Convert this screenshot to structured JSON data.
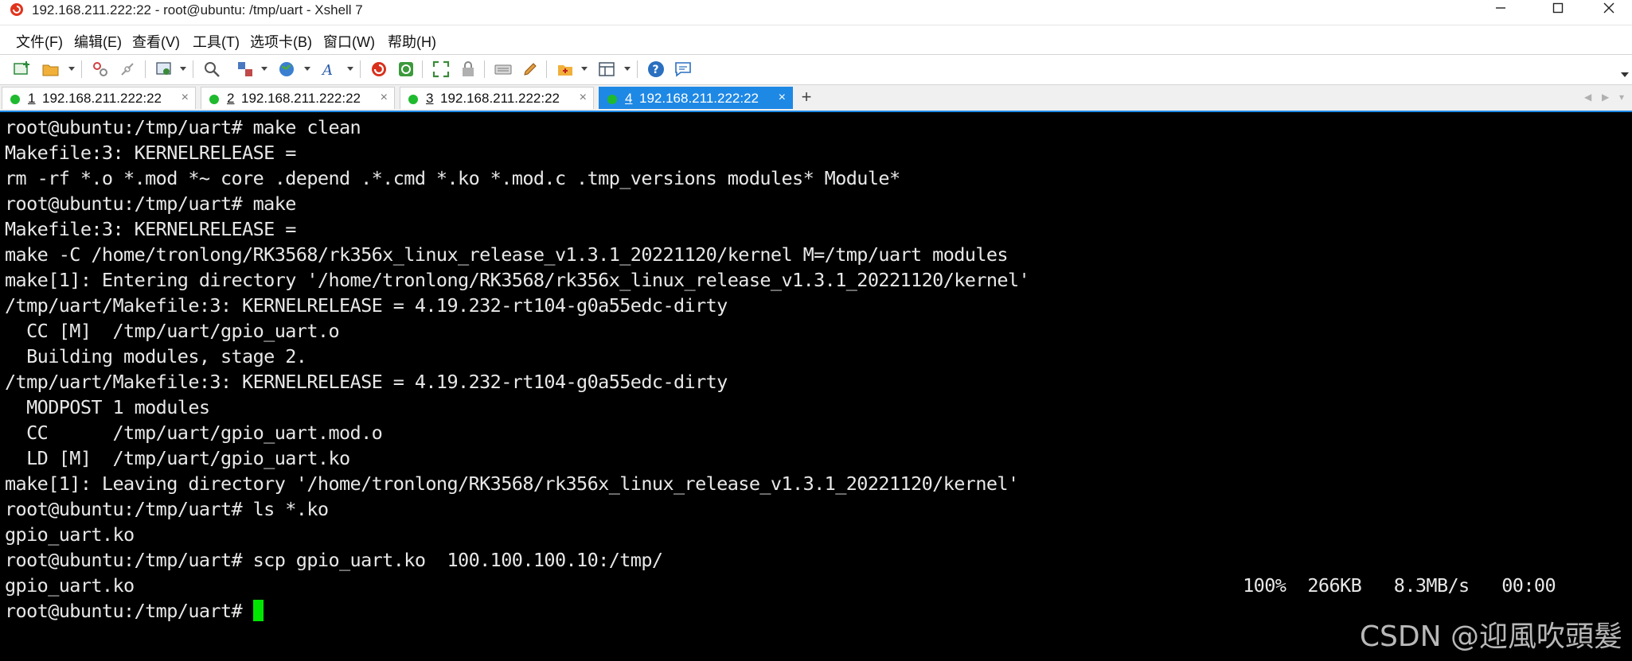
{
  "window": {
    "title": "192.168.211.222:22 - root@ubuntu: /tmp/uart - Xshell 7"
  },
  "menu": [
    "文件(F)",
    "编辑(E)",
    "查看(V)",
    "工具(T)",
    "选项卡(B)",
    "窗口(W)",
    "帮助(H)"
  ],
  "tabs": [
    {
      "num": "1",
      "label": "192.168.211.222:22"
    },
    {
      "num": "2",
      "label": "192.168.211.222:22"
    },
    {
      "num": "3",
      "label": "192.168.211.222:22"
    },
    {
      "num": "4",
      "label": "192.168.211.222:22"
    }
  ],
  "tab_close": "×",
  "tab_add": "+",
  "terminal": {
    "lines": [
      "root@ubuntu:/tmp/uart# make clean",
      "Makefile:3: KERNELRELEASE =",
      "rm -rf *.o *.mod *~ core .depend .*.cmd *.ko *.mod.c .tmp_versions modules* Module*",
      "root@ubuntu:/tmp/uart# make",
      "Makefile:3: KERNELRELEASE =",
      "make -C /home/tronlong/RK3568/rk356x_linux_release_v1.3.1_20221120/kernel M=/tmp/uart modules",
      "make[1]: Entering directory '/home/tronlong/RK3568/rk356x_linux_release_v1.3.1_20221120/kernel'",
      "/tmp/uart/Makefile:3: KERNELRELEASE = 4.19.232-rt104-g0a55edc-dirty",
      "  CC [M]  /tmp/uart/gpio_uart.o",
      "  Building modules, stage 2.",
      "/tmp/uart/Makefile:3: KERNELRELEASE = 4.19.232-rt104-g0a55edc-dirty",
      "  MODPOST 1 modules",
      "  CC      /tmp/uart/gpio_uart.mod.o",
      "  LD [M]  /tmp/uart/gpio_uart.ko",
      "make[1]: Leaving directory '/home/tronlong/RK3568/rk356x_linux_release_v1.3.1_20221120/kernel'",
      "root@ubuntu:/tmp/uart# ls *.ko",
      "gpio_uart.ko",
      "root@ubuntu:/tmp/uart# scp gpio_uart.ko  100.100.100.10:/tmp/",
      "gpio_uart.ko"
    ],
    "scp_stats": "100%  266KB   8.3MB/s   00:00",
    "prompt": "root@ubuntu:/tmp/uart# ",
    "cursor_color": "#00e600"
  },
  "watermark": "CSDN @迎風吹頭髮",
  "colors": {
    "active_tab": "#1e88e5",
    "status_dot": "#1fba2e",
    "terminal_bg": "#000000",
    "terminal_fg": "#e8e8e8"
  },
  "icons": [
    "new-session-icon",
    "open-folder-icon",
    "reconnect-icon",
    "disconnect-icon",
    "properties-icon",
    "find-icon",
    "transfer-icon",
    "globe-icon",
    "font-icon",
    "xshell-icon",
    "xftp-icon",
    "fullscreen-icon",
    "lock-icon",
    "keyboard-icon",
    "highlight-icon",
    "script-icon",
    "layout-icon",
    "help-icon",
    "chat-icon"
  ]
}
